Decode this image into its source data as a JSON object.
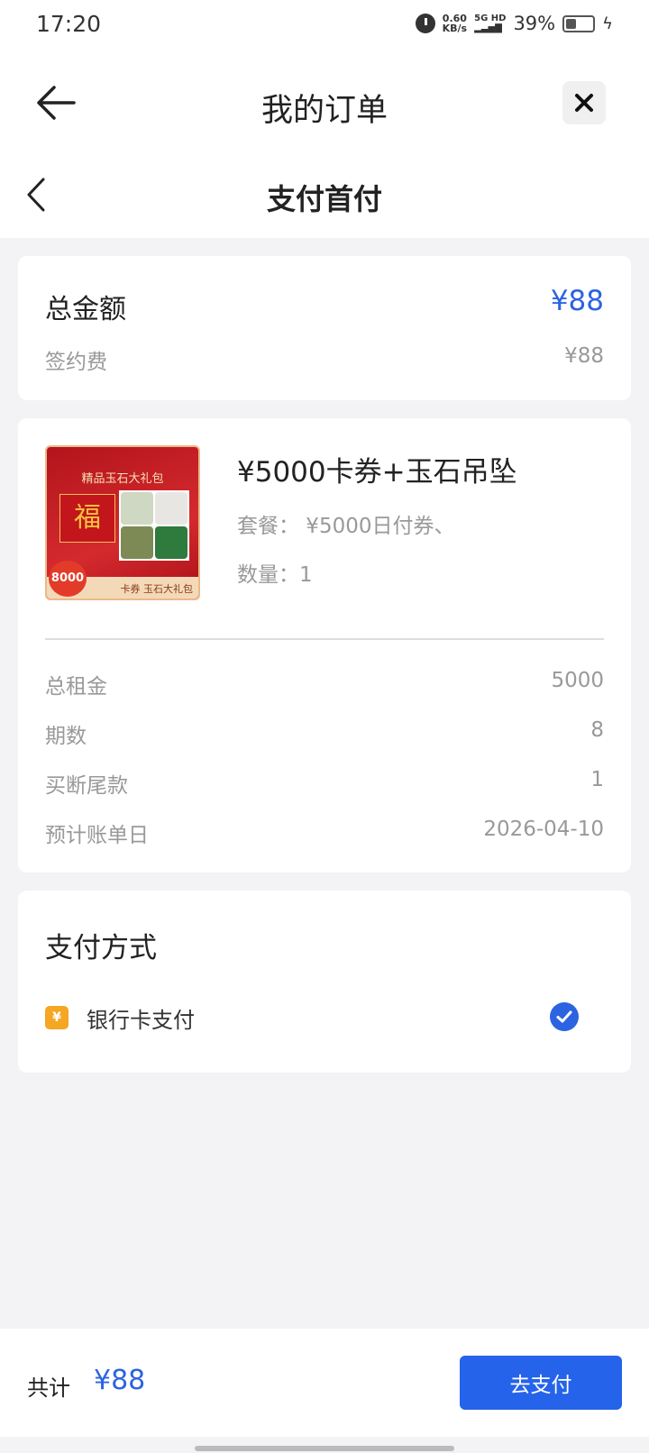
{
  "status_bar": {
    "time": "17:20",
    "net_speed_value": "0.60",
    "net_speed_unit": "KB/s",
    "signal_top": "5G HD",
    "battery_percent": "39%",
    "battery_level": 0.39
  },
  "nav": {
    "title": "我的订单",
    "page_title": "支付首付"
  },
  "total": {
    "label": "总金额",
    "value": "¥88",
    "fee_label": "签约费",
    "fee_value": "¥88"
  },
  "product": {
    "image_banner": "精品玉石大礼包",
    "image_fu": "福",
    "image_badge": "8000",
    "image_bottom": "卡券 玉石大礼包",
    "name": "¥5000卡券+玉石吊坠",
    "package": "套餐： ¥5000日付券、",
    "quantity": "数量：1"
  },
  "details": [
    {
      "label": "总租金",
      "value": "5000"
    },
    {
      "label": "期数",
      "value": "8"
    },
    {
      "label": "买断尾款",
      "value": "1"
    },
    {
      "label": "预计账单日",
      "value": "2026-04-10"
    }
  ],
  "payment": {
    "title": "支付方式",
    "method_label": "银行卡支付",
    "method_icon_glyph": "¥",
    "selected": true
  },
  "footer": {
    "sum_label": "共计",
    "sum_value": "¥88",
    "pay_button": "去支付"
  },
  "colors": {
    "accent": "#2c63e0",
    "button": "#2563eb",
    "bank_icon": "#f5a623"
  }
}
